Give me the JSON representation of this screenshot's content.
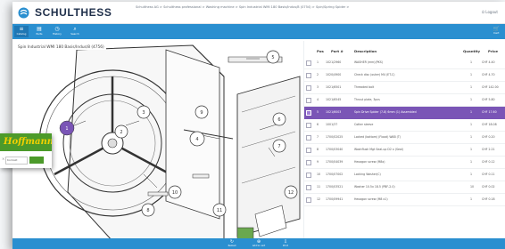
{
  "header": {
    "logo_text": "SCHULTHESS",
    "breadcrumb": "Schulthess AG > Schulthess professional > Washing machine > Spin Industrial WMI 180 Basis/Indus/8 (0754) > Spin/Spring Spider >",
    "logout_label": "Logout"
  },
  "nav": {
    "items": [
      {
        "icon": "≡",
        "label": "Catalog"
      },
      {
        "icon": "▤",
        "label": "Parts"
      },
      {
        "icon": "◷",
        "label": "History"
      },
      {
        "icon": "⌕",
        "label": "Search"
      },
      {
        "icon": "☰",
        "label": "Info"
      }
    ],
    "right_label": "Cart"
  },
  "drawing": {
    "title": "Spin Industrial WMI 180 Basis/Indus/8 (4756)"
  },
  "parts": {
    "columns": [
      "Pos",
      "Part #",
      "Description",
      "Quantity",
      "Price"
    ],
    "rows": [
      {
        "pos": "1",
        "part": "1021/2960",
        "desc": "WASHER (mm)(PKS)",
        "qty": "1",
        "price": "CHF 4.40"
      },
      {
        "pos": "2",
        "part": "1020/4900",
        "desc": "Check disc (outer) M4 (ET-C)",
        "qty": "1",
        "price": "CHF 4.70"
      },
      {
        "pos": "3",
        "part": "1021/6501",
        "desc": "Threaded bolt",
        "qty": "1",
        "price": "CHF 142.00"
      },
      {
        "pos": "4",
        "part": "1021/6545",
        "desc": "Thrust plate, 3pcs",
        "qty": "1",
        "price": "CHF 5.80"
      },
      {
        "pos": "5",
        "part": "1021/6003",
        "desc": "Spin Drive Spider (7-8) 6mm (1) Assembled",
        "qty": "1",
        "price": "CHF 17.60"
      },
      {
        "pos": "6",
        "part": "1001/37",
        "desc": "Cotter sleeve",
        "qty": "1",
        "price": "CHF 18.08"
      },
      {
        "pos": "7",
        "part": "1700/02025",
        "desc": "Locked (bottom) (Flood) WAB (T)",
        "qty": "1",
        "price": "CHF 0.20"
      },
      {
        "pos": "8",
        "part": "1700/03040",
        "desc": "Washflush Mgt Seal-up D2 x (Seal)",
        "qty": "1",
        "price": "CHF 2.21"
      },
      {
        "pos": "9",
        "part": "1700/04039",
        "desc": "Hexagon screw (M8x)",
        "qty": "1",
        "price": "CHF 0.12"
      },
      {
        "pos": "10",
        "part": "1700/07002",
        "desc": "Locking Washer(C)",
        "qty": "1",
        "price": "CHF 0.11"
      },
      {
        "pos": "11",
        "part": "1700/03521",
        "desc": "Washer 10.5x 18.5 (PBF-2.0)",
        "qty": "10",
        "price": "CHF 0.02"
      },
      {
        "pos": "12",
        "part": "1700/09941",
        "desc": "Hexagon screw (M8 x1)",
        "qty": "1",
        "price": "CHF 0.18"
      }
    ]
  },
  "bottom": {
    "items": [
      {
        "icon": "↻",
        "label": "Reload"
      },
      {
        "icon": "⊕",
        "label": "Add to cart"
      },
      {
        "icon": "⇩",
        "label": "Print"
      }
    ]
  },
  "sticker": {
    "brand": "Hoffmann",
    "field_text": "Kontakt",
    "close_icon": "×"
  },
  "colors": {
    "brand_blue": "#2a8fd0",
    "selected_row": "#7a55b6",
    "sticker_green": "#4c9a2a",
    "sticker_yellow": "#f4d000"
  },
  "callouts": [
    "1",
    "2",
    "3",
    "4",
    "5",
    "6",
    "7",
    "8",
    "9",
    "10",
    "11",
    "12"
  ]
}
